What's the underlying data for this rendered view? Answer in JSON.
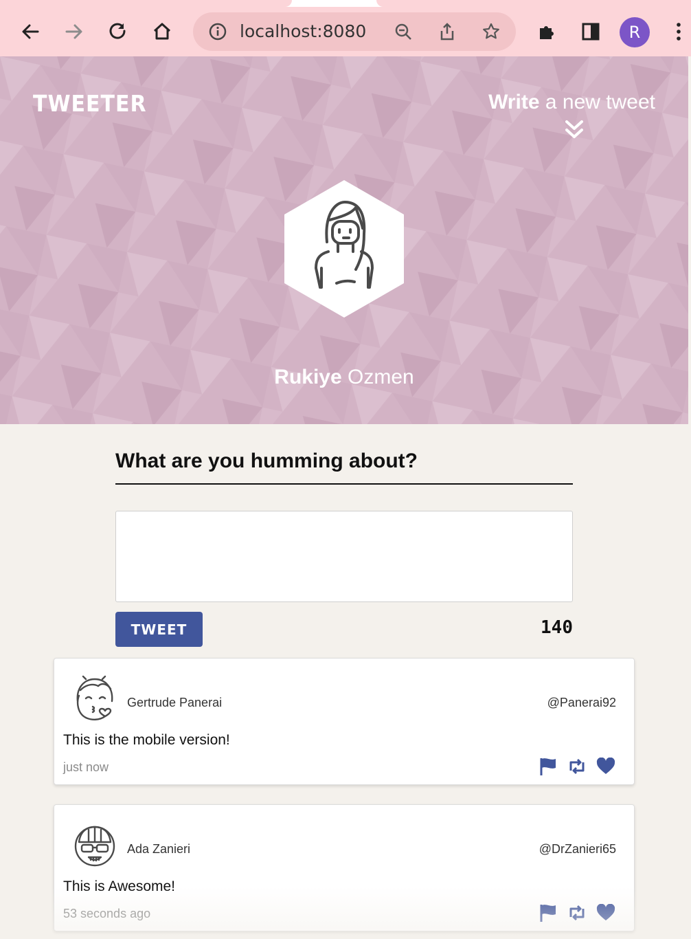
{
  "browser": {
    "url": "localhost:8080",
    "profile_initial": "R",
    "profile_color": "#7c55c7",
    "chrome_color": "#fcd5d9",
    "icons": [
      "back-arrow-icon",
      "forward-arrow-icon",
      "reload-icon",
      "home-icon",
      "info-icon",
      "zoom-out-icon",
      "share-icon",
      "bookmark-star-icon",
      "extensions-icon",
      "side-panel-icon",
      "menu-dots-icon"
    ]
  },
  "header": {
    "brand": "TWEETER",
    "write_bold": "Write",
    "write_rest": " a new tweet",
    "user_first": "Rukiye",
    "user_last": " Ozmen",
    "banner_color": "#d3b3c5"
  },
  "compose": {
    "title": "What are you humming about?",
    "value": "",
    "button_label": "TWEET",
    "counter": "140",
    "button_color": "#41569c"
  },
  "tweets": [
    {
      "name": "Gertrude Panerai",
      "handle": "@Panerai92",
      "text": "This is the mobile version!",
      "time": "just now"
    },
    {
      "name": "Ada Zanieri",
      "handle": "@DrZanieri65",
      "text": "This is Awesome!",
      "time": "53 seconds ago"
    }
  ]
}
